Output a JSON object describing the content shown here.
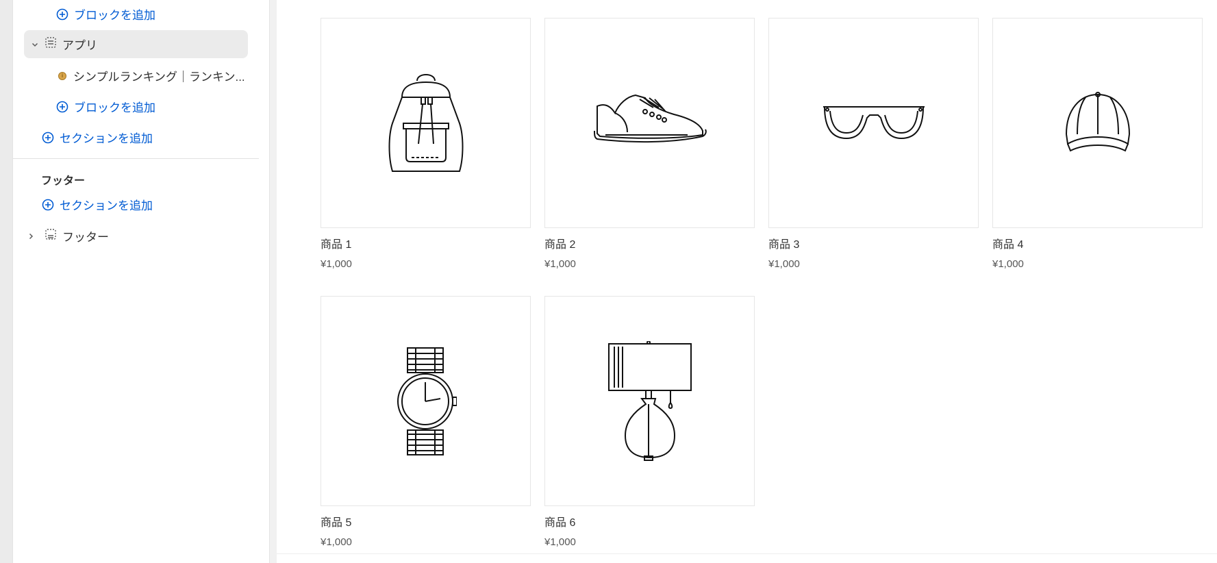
{
  "sidebar": {
    "add_block_label_top": "ブロックを追加",
    "apps_section_label": "アプリ",
    "app_block_label": "シンプルランキング｜ランキン...",
    "app_block_badge": "i",
    "add_block_label": "ブロックを追加",
    "add_section_label": "セクションを追加",
    "footer_group_title": "フッター",
    "footer_add_section_label": "セクションを追加",
    "footer_section_label": "フッター"
  },
  "products": [
    {
      "title": "商品 1",
      "price": "¥1,000",
      "icon": "backpack-icon"
    },
    {
      "title": "商品 2",
      "price": "¥1,000",
      "icon": "sneaker-icon"
    },
    {
      "title": "商品 3",
      "price": "¥1,000",
      "icon": "sunglasses-icon"
    },
    {
      "title": "商品 4",
      "price": "¥1,000",
      "icon": "cap-icon"
    },
    {
      "title": "商品 5",
      "price": "¥1,000",
      "icon": "watch-icon"
    },
    {
      "title": "商品 6",
      "price": "¥1,000",
      "icon": "lamp-icon"
    }
  ],
  "colors": {
    "link": "#005bd3",
    "text": "#303030",
    "selected_row": "#ebebeb"
  }
}
